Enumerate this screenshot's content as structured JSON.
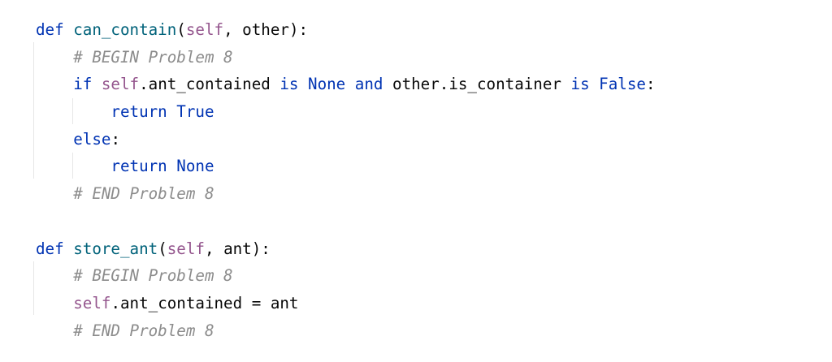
{
  "editor": {
    "lines": [
      {
        "tokens": [
          {
            "t": "def ",
            "c": "kw"
          },
          {
            "t": "can_contain",
            "c": "fn"
          },
          {
            "t": "(",
            "c": ""
          },
          {
            "t": "self",
            "c": "self"
          },
          {
            "t": ", other):",
            "c": ""
          }
        ]
      },
      {
        "tokens": [
          {
            "t": "    ",
            "c": ""
          },
          {
            "t": "# BEGIN Problem 8",
            "c": "cm"
          }
        ]
      },
      {
        "tokens": [
          {
            "t": "    ",
            "c": ""
          },
          {
            "t": "if ",
            "c": "kw"
          },
          {
            "t": "self",
            "c": "self"
          },
          {
            "t": ".ant_contained ",
            "c": ""
          },
          {
            "t": "is ",
            "c": "kw"
          },
          {
            "t": "None ",
            "c": "kw"
          },
          {
            "t": "and ",
            "c": "kw"
          },
          {
            "t": "other.is_container ",
            "c": ""
          },
          {
            "t": "is ",
            "c": "kw"
          },
          {
            "t": "False",
            "c": "kw"
          },
          {
            "t": ":",
            "c": ""
          }
        ]
      },
      {
        "tokens": [
          {
            "t": "        ",
            "c": ""
          },
          {
            "t": "return ",
            "c": "kw"
          },
          {
            "t": "True",
            "c": "kw"
          }
        ]
      },
      {
        "tokens": [
          {
            "t": "    ",
            "c": ""
          },
          {
            "t": "else",
            "c": "kw"
          },
          {
            "t": ":",
            "c": ""
          }
        ]
      },
      {
        "tokens": [
          {
            "t": "        ",
            "c": ""
          },
          {
            "t": "return ",
            "c": "kw"
          },
          {
            "t": "None",
            "c": "kw"
          }
        ]
      },
      {
        "tokens": [
          {
            "t": "    ",
            "c": ""
          },
          {
            "t": "# END Problem 8",
            "c": "cm"
          }
        ]
      },
      {
        "tokens": []
      },
      {
        "tokens": [
          {
            "t": "def ",
            "c": "kw"
          },
          {
            "t": "store_ant",
            "c": "fn"
          },
          {
            "t": "(",
            "c": ""
          },
          {
            "t": "self",
            "c": "self"
          },
          {
            "t": ", ant):",
            "c": ""
          }
        ]
      },
      {
        "tokens": [
          {
            "t": "    ",
            "c": ""
          },
          {
            "t": "# BEGIN Problem 8",
            "c": "cm"
          }
        ]
      },
      {
        "tokens": [
          {
            "t": "    ",
            "c": ""
          },
          {
            "t": "self",
            "c": "self"
          },
          {
            "t": ".ant_contained = ant",
            "c": ""
          }
        ]
      },
      {
        "tokens": [
          {
            "t": "    ",
            "c": ""
          },
          {
            "t": "# END Problem 8",
            "c": "cm"
          }
        ]
      }
    ]
  },
  "colors": {
    "keyword": "#0033b3",
    "function": "#00627a",
    "self": "#94558d",
    "comment": "#8c8c8c",
    "text": "#080808",
    "background": "#ffffff"
  }
}
